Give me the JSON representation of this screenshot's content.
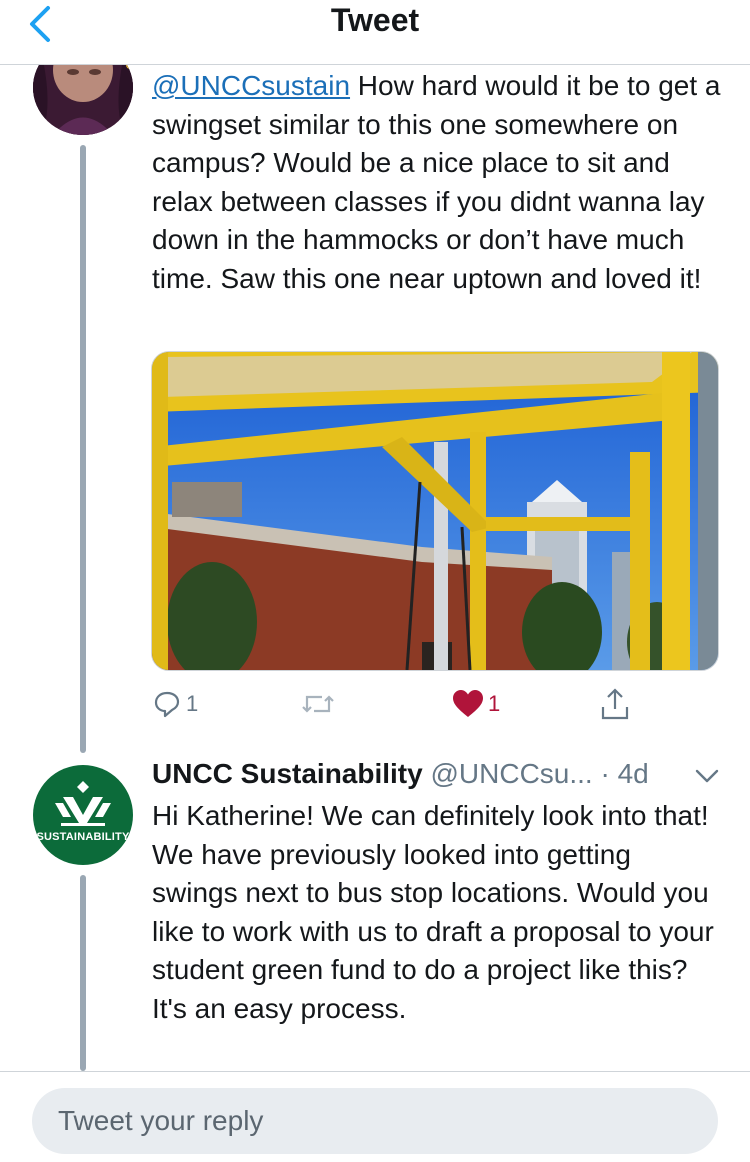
{
  "header": {
    "title": "Tweet",
    "back_icon": "chevron-left-icon"
  },
  "colors": {
    "accent": "#1da1f2",
    "link": "#1b6fb8",
    "like": "#b0143a",
    "brand_green": "#0c6b3a",
    "thread_line": "#9aa7b3"
  },
  "tweet1": {
    "mention": "@UNCCsustain",
    "text": " How hard would it be to get a swingset similar to this one somewhere on campus? Would be a nice place to sit and relax between classes if you didnt wanna lay down in the hammocks or don’t have much time. Saw this one near uptown and loved it!",
    "replies": "1",
    "retweets": "",
    "likes": "1",
    "liked": true
  },
  "tweet2": {
    "author_name": "UNCC Sustainability",
    "author_handle": "@UNCCsu...",
    "time": "· 4d",
    "avatar_label": "SUSTAINABILITY",
    "text": "Hi Katherine! We can definitely look into that! We have previously looked into getting swings next to bus stop locations. Would you like to work with us to draft a proposal to your student green fund to do a project like this? It's an easy process."
  },
  "reply": {
    "placeholder": "Tweet your reply",
    "value": ""
  }
}
